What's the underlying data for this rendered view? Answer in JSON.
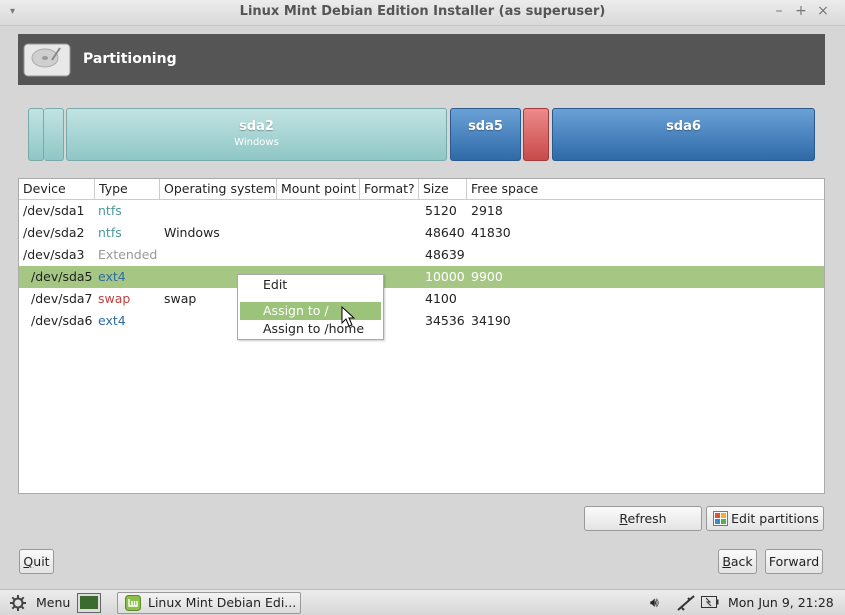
{
  "window": {
    "title": "Linux Mint Debian Edition Installer (as superuser)",
    "menu_glyph": "▾",
    "minimize": "–",
    "maximize": "+",
    "close": "×"
  },
  "header": {
    "title": "Partitioning",
    "icon": "hard-disk-icon"
  },
  "partition_bar": [
    {
      "name": "",
      "sub": ""
    },
    {
      "name": "sda2",
      "sub": "Windows"
    },
    {
      "name": "sda5",
      "sub": ""
    },
    {
      "name": "",
      "sub": ""
    },
    {
      "name": "sda6",
      "sub": ""
    }
  ],
  "table": {
    "headers": [
      "Device",
      "Type",
      "Operating system",
      "Mount point",
      "Format?",
      "Size",
      "Free space"
    ],
    "rows": [
      {
        "device": "/dev/sda1",
        "type": "ntfs",
        "os": "",
        "mount": "",
        "format": "",
        "size": "5120",
        "free": "2918"
      },
      {
        "device": "/dev/sda2",
        "type": "ntfs",
        "os": "Windows",
        "mount": "",
        "format": "",
        "size": "48640",
        "free": "41830"
      },
      {
        "device": "/dev/sda3",
        "type": "Extended",
        "os": "",
        "mount": "",
        "format": "",
        "size": "48639",
        "free": ""
      },
      {
        "device": "/dev/sda5",
        "type": "ext4",
        "os": "",
        "mount": "",
        "format": "",
        "size": "10000",
        "free": "9900"
      },
      {
        "device": "/dev/sda7",
        "type": "swap",
        "os": "swap",
        "mount": "",
        "format": "",
        "size": "4100",
        "free": ""
      },
      {
        "device": "/dev/sda6",
        "type": "ext4",
        "os": "",
        "mount": "",
        "format": "",
        "size": "34536",
        "free": "34190"
      }
    ]
  },
  "context_menu": {
    "items": [
      "Edit",
      "Assign to /",
      "Assign to /home"
    ],
    "highlighted": "Assign to /"
  },
  "buttons": {
    "refresh_prefix": "R",
    "refresh_rest": "efresh",
    "edit_partitions": "Edit partitions",
    "quit_prefix": "Q",
    "quit_rest": "uit",
    "back_prefix": "B",
    "back_rest": "ack",
    "forward": "Forward"
  },
  "taskbar": {
    "menu_label": "Menu",
    "window_label": "Linux Mint Debian Edi...",
    "clock": "Mon Jun  9, 21:28"
  },
  "colors": {
    "selection": "#a6c784",
    "menu_highlight": "#9cc37a",
    "ntfs": "#4a9a9a",
    "ext4": "#2f6aa8",
    "swap": "#c04040"
  }
}
